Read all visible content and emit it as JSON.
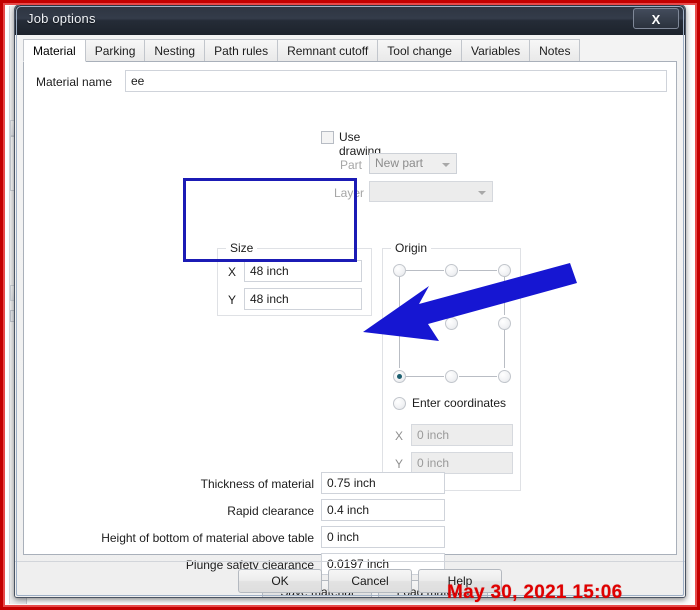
{
  "window": {
    "title": "Job options",
    "close_label": "X"
  },
  "tabs": [
    {
      "label": "Material",
      "active": true
    },
    {
      "label": "Parking",
      "active": false
    },
    {
      "label": "Nesting",
      "active": false
    },
    {
      "label": "Path rules",
      "active": false
    },
    {
      "label": "Remnant cutoff",
      "active": false
    },
    {
      "label": "Tool change",
      "active": false
    },
    {
      "label": "Variables",
      "active": false
    },
    {
      "label": "Notes",
      "active": false
    }
  ],
  "material": {
    "name_label": "Material name",
    "name_value": "ee",
    "use_drawing_label": "Use drawing",
    "use_drawing_checked": false,
    "part_label": "Part",
    "part_value": "New part",
    "layer_label": "Layer",
    "layer_value": ""
  },
  "size": {
    "title": "Size",
    "x_label": "X",
    "x_value": "48 inch",
    "y_label": "Y",
    "y_value": "48 inch"
  },
  "origin": {
    "title": "Origin",
    "selected_cell": "bottom-left",
    "enter_coordinates_label": "Enter coordinates",
    "enter_coordinates_selected": false,
    "x_label": "X",
    "x_value": "0 inch",
    "y_label": "Y",
    "y_value": "0 inch"
  },
  "fields": [
    {
      "label": "Thickness of material",
      "value": "0.75 inch"
    },
    {
      "label": "Rapid clearance",
      "value": "0.4 inch"
    },
    {
      "label": "Height of bottom of material above table",
      "value": "0 inch"
    },
    {
      "label": "Plunge safety clearance",
      "value": "0.0197 inch"
    }
  ],
  "material_buttons": {
    "save": "Save material",
    "load": "Load material"
  },
  "footer_buttons": {
    "ok": "OK",
    "cancel": "Cancel",
    "help": "Help"
  },
  "annotation": {
    "arrow_color": "#1616d2",
    "highlight_color": "#1b1bb5",
    "timestamp": "May 30, 2021 15:06",
    "timestamp_color": "#e00000"
  }
}
